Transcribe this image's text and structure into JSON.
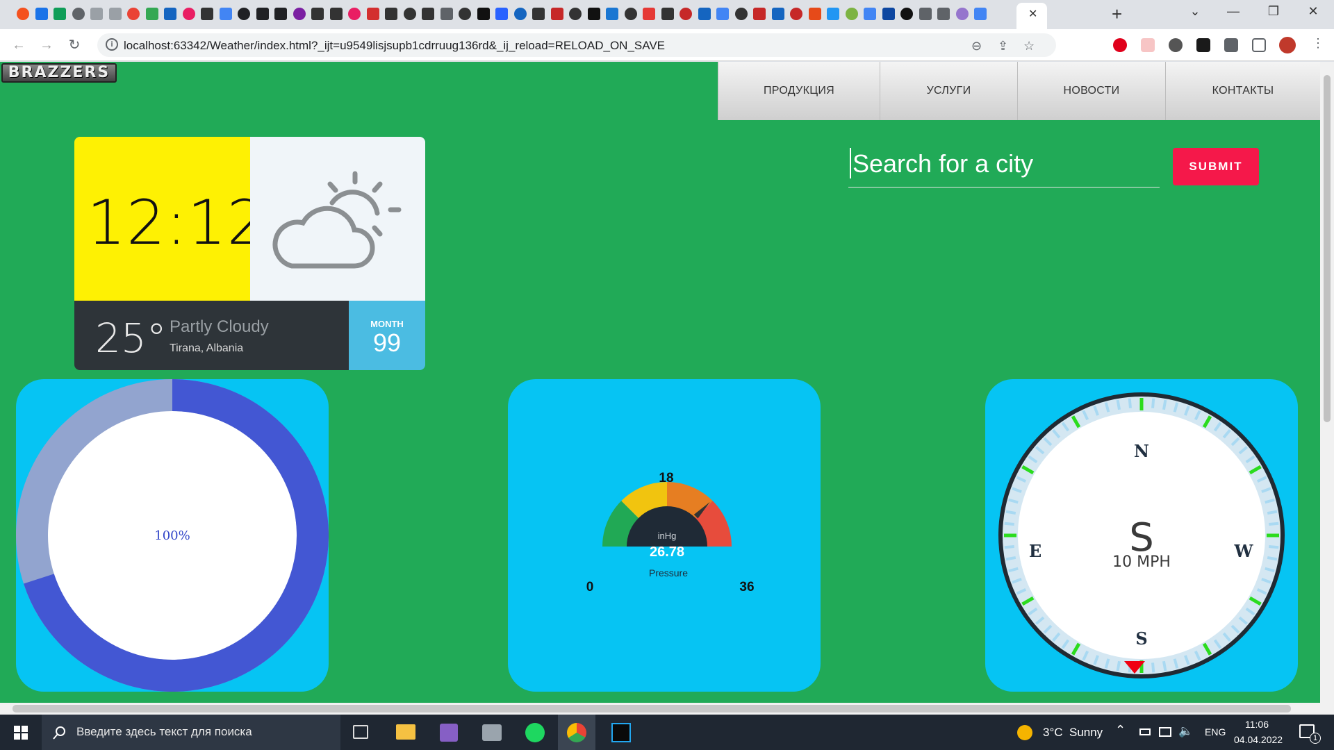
{
  "browser": {
    "url": "localhost:63342/Weather/index.html?_ijt=u9549lisjsupb1cdrruug136rd&_ij_reload=RELOAD_ON_SAVE",
    "tab_close": "✕",
    "new_tab": "+"
  },
  "site": {
    "logo": "BRAZZERS",
    "menu": [
      "ПРОДУКЦИЯ",
      "УСЛУГИ",
      "НОВОСТИ",
      "КОНТАКТЫ"
    ]
  },
  "weather": {
    "time": "12:12",
    "temperature": "25°",
    "condition": "Partly Cloudy",
    "location": "Tirana, Albania",
    "month_label": "MONTH",
    "month_value": "99",
    "icon": "partly-cloudy-icon"
  },
  "search": {
    "placeholder": "Search for a city",
    "submit": "SUBMIT"
  },
  "humidity": {
    "label": "100%",
    "value": 100,
    "colors": {
      "fill": "#4357d3",
      "rest": "#92a4cf"
    }
  },
  "pressure": {
    "unit": "inHg",
    "value": "26.78",
    "reading": 26.78,
    "label": "Pressure",
    "min": "0",
    "mid": "18",
    "max": "36",
    "range": [
      0,
      36
    ],
    "colors": [
      "#21a955",
      "#f1c40f",
      "#e67e22",
      "#e74c3c"
    ]
  },
  "compass": {
    "north": "N",
    "south": "S",
    "east": "E",
    "west": "W",
    "direction": "S",
    "speed": "10 MPH"
  },
  "taskbar": {
    "search_placeholder": "Введите здесь текст для поиска",
    "weather": "3°C  Sunny",
    "language": "ENG",
    "time": "11:06",
    "date": "04.04.2022",
    "notifications": "1"
  }
}
